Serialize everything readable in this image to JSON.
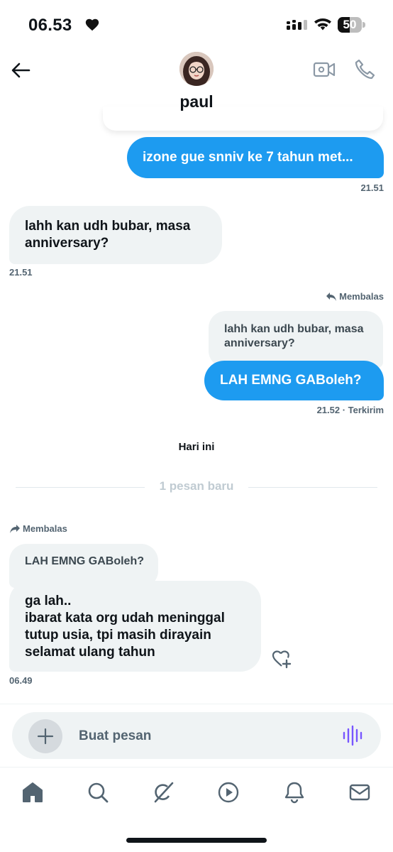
{
  "status_bar": {
    "time": "06.53",
    "battery": "50",
    "battery_level": 0.5
  },
  "header": {
    "contact_name": "paul"
  },
  "messages": {
    "m1": {
      "text": "izone gue snniv ke 7 tahun met...",
      "time": "21.51"
    },
    "m2": {
      "text": "lahh kan udh bubar, masa anniversary?",
      "time": "21.51"
    },
    "m3": {
      "reply_label": "Membalas",
      "quoted": "lahh kan udh bubar, masa anniversary?",
      "text": "LAH EMNG GABoleh?",
      "time": "21.52 · Terkirim"
    },
    "day_separator": "Hari ini",
    "new_messages": "1 pesan baru",
    "m4": {
      "reply_label": "Membalas",
      "quoted": "LAH EMNG GABoleh?",
      "text": "ga lah..\nibarat kata org udah meninggal tutup usia, tpi masih dirayain selamat ulang tahun",
      "time": "06.49"
    }
  },
  "composer": {
    "placeholder": "Buat pesan"
  },
  "colors": {
    "accent": "#1d9bf0",
    "voice": "#7856ff",
    "bubble_in": "#eff3f4"
  },
  "icons": [
    "back-arrow-icon",
    "video-call-icon",
    "phone-call-icon",
    "reply-icon",
    "add-reaction-icon",
    "plus-icon",
    "voice-wave-icon",
    "home-icon",
    "search-icon",
    "grok-icon",
    "video-icon",
    "notifications-icon",
    "messages-icon"
  ]
}
